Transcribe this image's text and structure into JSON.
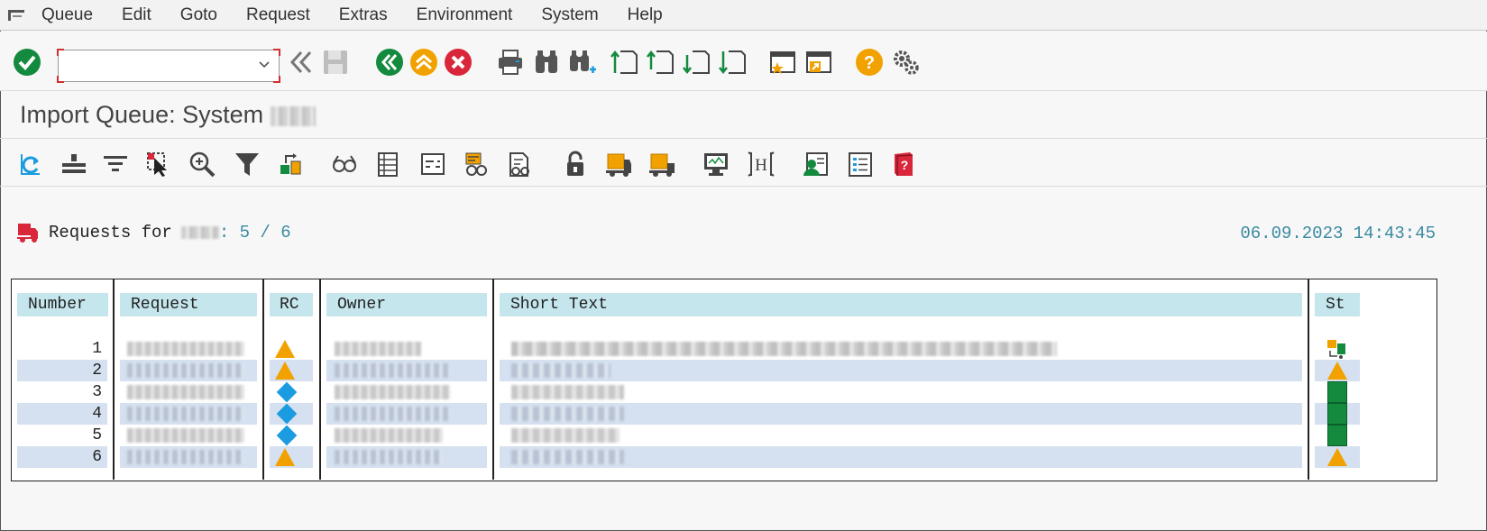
{
  "menu": {
    "items": [
      {
        "label": "Queue"
      },
      {
        "label": "Edit"
      },
      {
        "label": "Goto"
      },
      {
        "label": "Request"
      },
      {
        "label": "Extras"
      },
      {
        "label": "Environment"
      },
      {
        "label": "System"
      },
      {
        "label": "Help"
      }
    ]
  },
  "toolbar": {
    "command_field": {
      "value": "",
      "placeholder": ""
    },
    "icons": [
      "enter-icon",
      "back-icon",
      "save-icon",
      "back-green-icon",
      "exit-icon",
      "cancel-icon",
      "print-icon",
      "find-icon",
      "find-next-icon",
      "first-page-icon",
      "previous-page-icon",
      "next-page-icon",
      "last-page-icon",
      "create-session-icon",
      "shortcut-icon",
      "help-icon",
      "customize-icon"
    ]
  },
  "title": {
    "text": "Import Queue: System"
  },
  "app_toolbar": {
    "icons": [
      "refresh-icon",
      "expand-icon",
      "filter-lines-icon",
      "select-icon",
      "zoom-icon",
      "filter-icon",
      "import-icon",
      "display-icon",
      "detail-list-icon",
      "log-icon",
      "object-icon",
      "check-icon",
      "lock-icon",
      "truck-import-icon",
      "truck-import-all-icon",
      "monitor-icon",
      "history-icon",
      "user-icon",
      "list-icon",
      "book-icon"
    ]
  },
  "report": {
    "requests_label": "Requests for",
    "requests_count": ": 5 / 6",
    "timestamp": "06.09.2023 14:43:45"
  },
  "table": {
    "columns": [
      "Number",
      "Request",
      "RC",
      "Owner",
      "Short Text",
      "St"
    ],
    "rows": [
      {
        "number": "1",
        "rc": "warning",
        "st": "import-icon"
      },
      {
        "number": "2",
        "rc": "warning",
        "st": "warning"
      },
      {
        "number": "3",
        "rc": "info",
        "st": "ok"
      },
      {
        "number": "4",
        "rc": "info",
        "st": "ok"
      },
      {
        "number": "5",
        "rc": "info",
        "st": "ok"
      },
      {
        "number": "6",
        "rc": "warning",
        "st": "warning"
      }
    ]
  },
  "colors": {
    "green": "#138a3e",
    "orange": "#f2a200",
    "red": "#d9263a",
    "blue": "#1b9ce0",
    "header_bg": "#c5e6ed",
    "row_alt": "#d5e0f0",
    "teal_text": "#3a8aa0"
  }
}
